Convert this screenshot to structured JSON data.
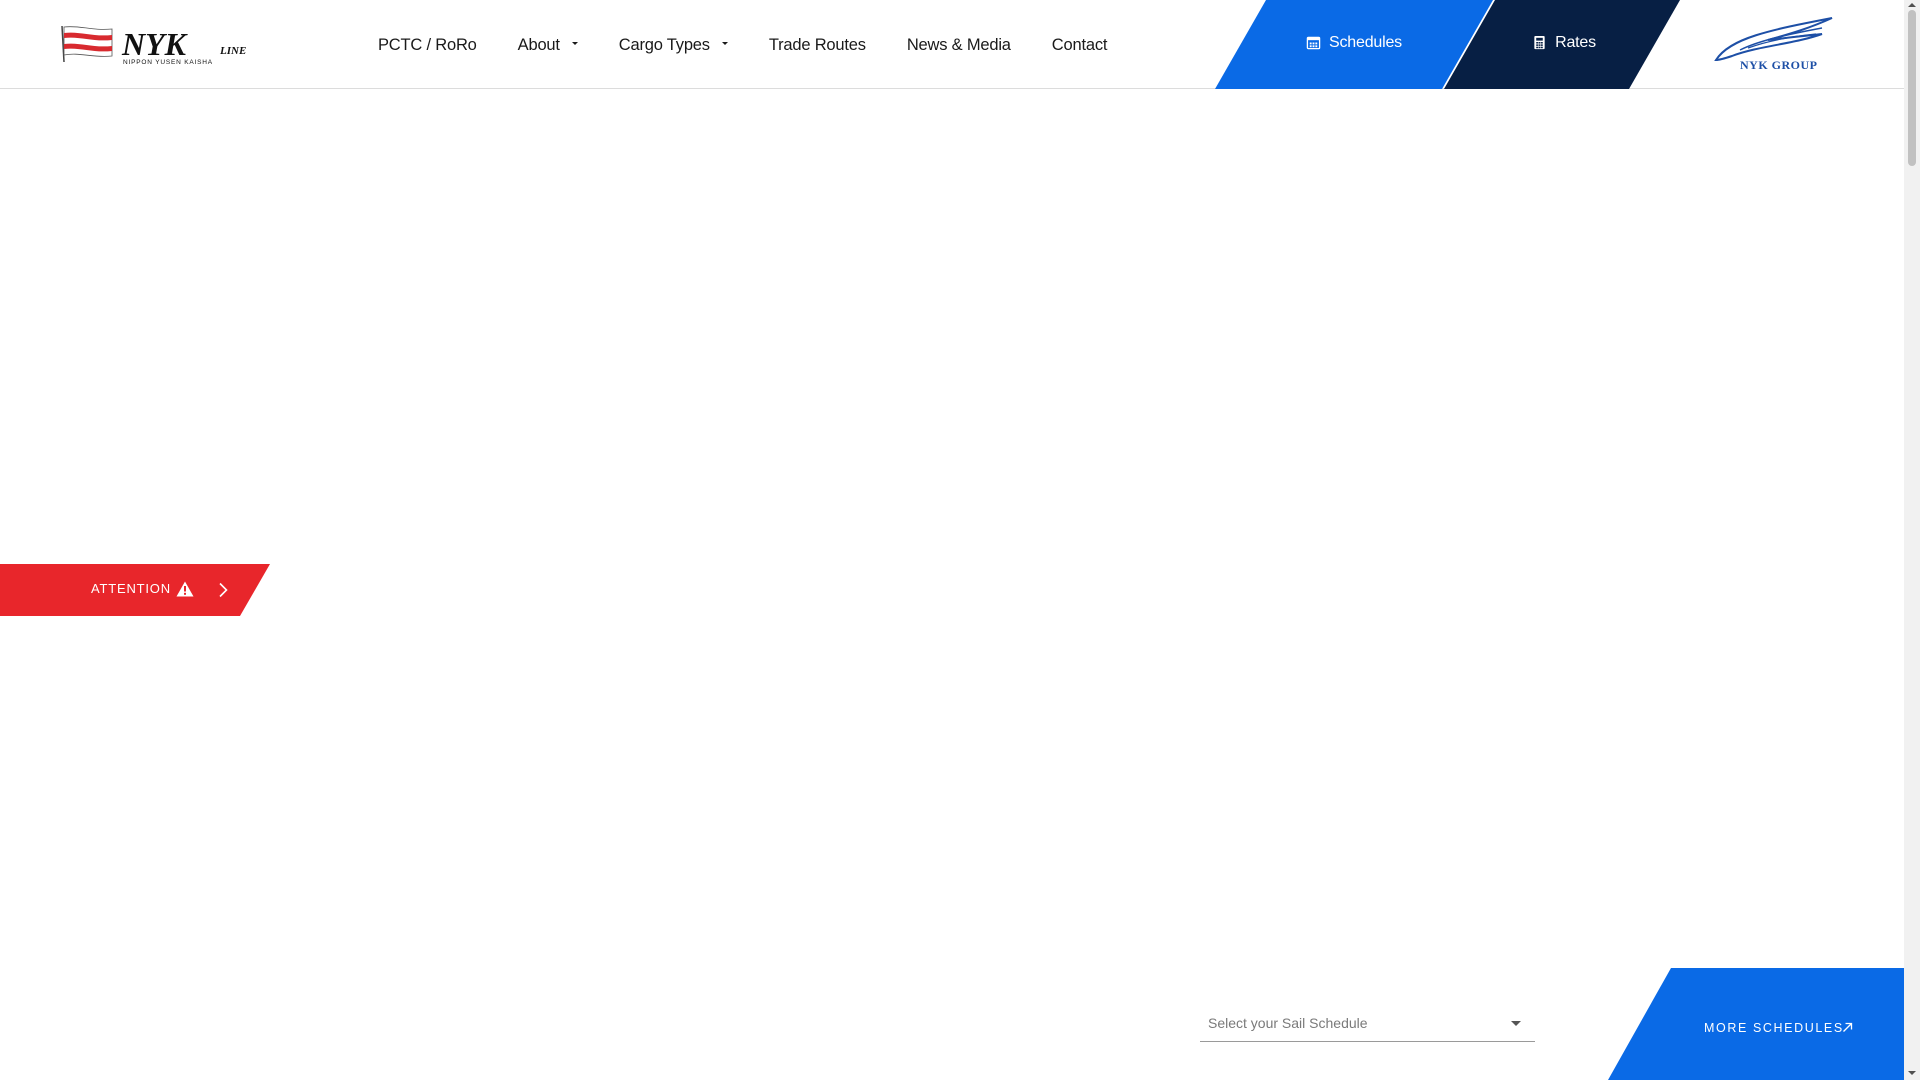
{
  "header": {
    "logo": {
      "text_main": "NYK",
      "text_suffix": "LINE",
      "text_sub": "NIPPON YUSEN KAISHA"
    },
    "nav": [
      {
        "label": "PCTC / RoRo",
        "dropdown": false
      },
      {
        "label": "About",
        "dropdown": true
      },
      {
        "label": "Cargo Types",
        "dropdown": true
      },
      {
        "label": "Trade Routes",
        "dropdown": false
      },
      {
        "label": "News & Media",
        "dropdown": false
      },
      {
        "label": "Contact",
        "dropdown": false
      }
    ],
    "schedules_button": {
      "label": "Schedules",
      "icon": "calendar-icon",
      "color": "#0a6ae6"
    },
    "rates_button": {
      "label": "Rates",
      "icon": "calculator-icon",
      "color": "#071f44"
    },
    "group_logo": {
      "text": "NYK GROUP",
      "color": "#1d4fa6"
    }
  },
  "attention": {
    "label": "ATTENTION",
    "icon": "warning-icon",
    "color": "#e8262b"
  },
  "schedule": {
    "placeholder": "Select your Sail Schedule",
    "more_label": "MORE SCHEDULES"
  }
}
